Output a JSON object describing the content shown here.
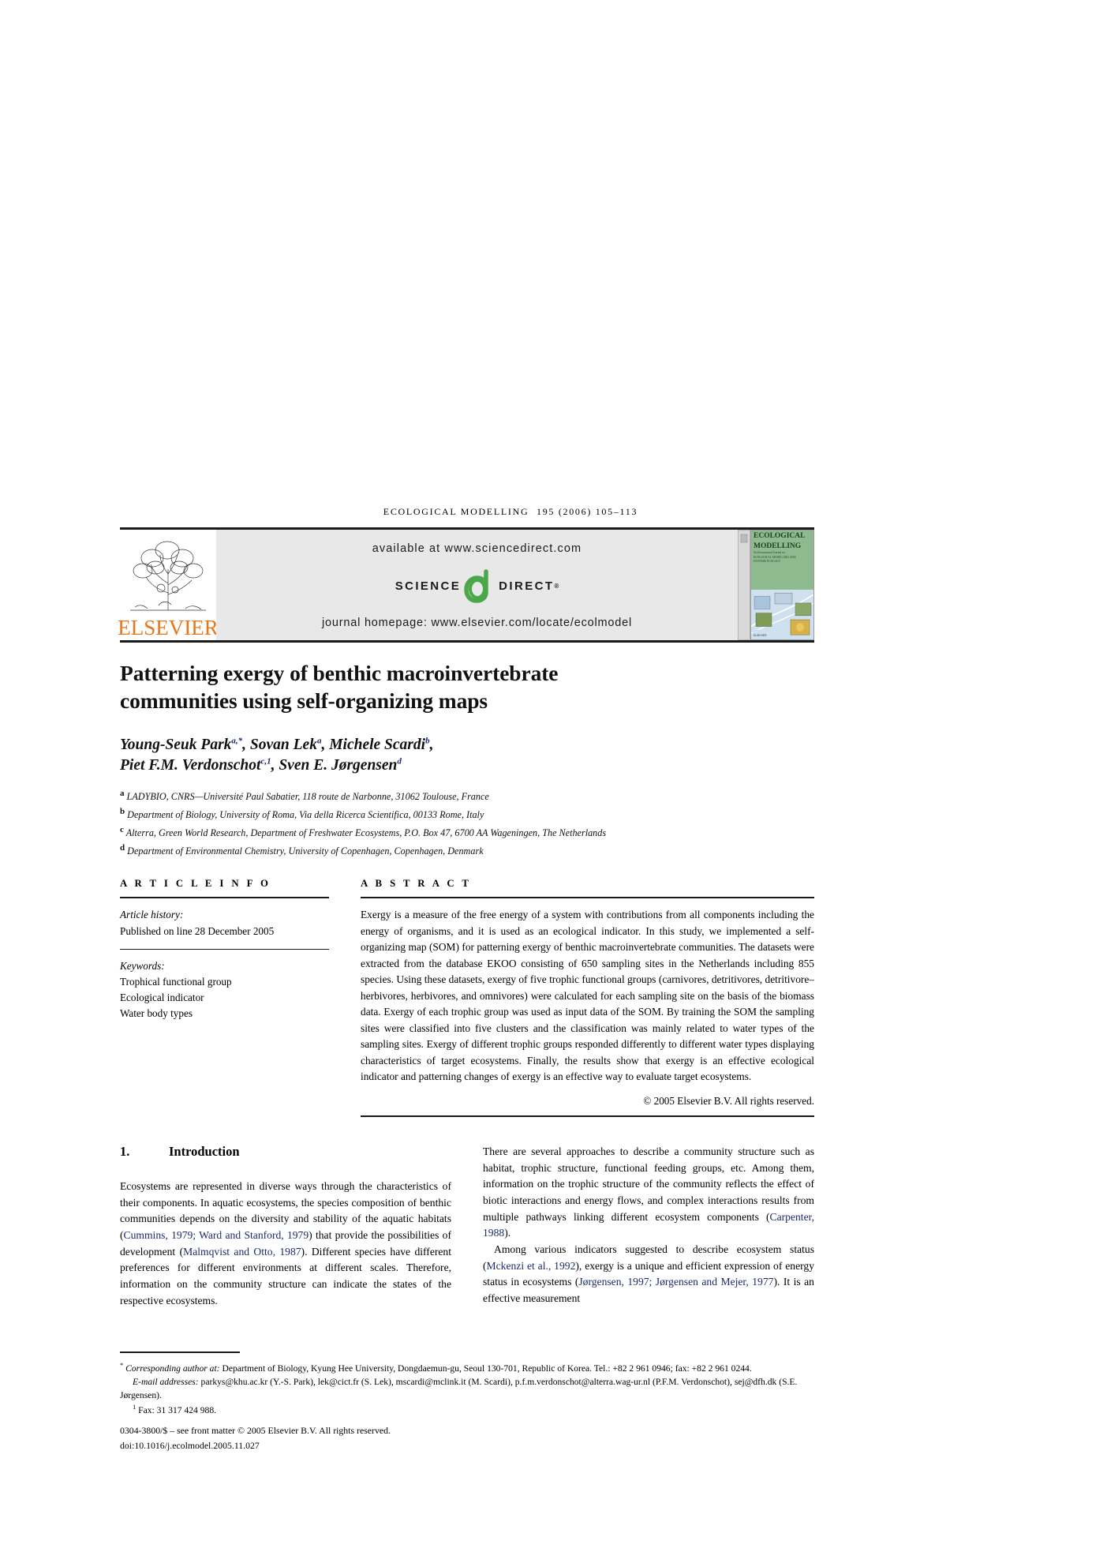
{
  "running_head": {
    "journal": "ECOLOGICAL MODELLING",
    "citation": "195 (2006) 105–113"
  },
  "masthead": {
    "publisher_name": "ELSEVIER",
    "available_at": "available at www.sciencedirect.com",
    "science_word": "SCIENCE",
    "direct_word": "DIRECT",
    "registered_mark": "®",
    "journal_homepage": "journal homepage: www.elsevier.com/locate/ecolmodel",
    "cover": {
      "line1": "ECOLOGICAL",
      "line2": "MODELLING",
      "sub1": "An International Journal on",
      "sub2": "ECOLOGICAL MODELLING AND",
      "sub3": "SYSTEMS ECOLOGY",
      "footer1": "ELSEVIER",
      "footer2": "www.elsevier.com"
    }
  },
  "article": {
    "title_line1": "Patterning exergy of benthic macroinvertebrate",
    "title_line2": "communities using self-organizing maps",
    "authors_line1_parts": [
      {
        "name": "Young-Seuk Park",
        "sup": "a,*"
      },
      {
        "name": "Sovan Lek",
        "sup": "a"
      },
      {
        "name": "Michele Scardi",
        "sup": "b"
      }
    ],
    "authors_line2_parts": [
      {
        "name": "Piet F.M. Verdonschot",
        "sup": "c,1"
      },
      {
        "name": "Sven E. Jørgensen",
        "sup": "d"
      }
    ],
    "affiliations": [
      {
        "marker": "a",
        "text": "LADYBIO, CNRS—Université Paul Sabatier, 118 route de Narbonne, 31062 Toulouse, France"
      },
      {
        "marker": "b",
        "text": "Department of Biology, University of Roma, Via della Ricerca Scientifica, 00133 Rome, Italy"
      },
      {
        "marker": "c",
        "text": "Alterra, Green World Research, Department of Freshwater Ecosystems, P.O. Box 47, 6700 AA Wageningen, The Netherlands"
      },
      {
        "marker": "d",
        "text": "Department of Environmental Chemistry, University of Copenhagen, Copenhagen, Denmark"
      }
    ]
  },
  "article_info": {
    "heading": "A R T I C L E  I N F O",
    "history_label": "Article history:",
    "history_value": "Published on line 28 December 2005",
    "keywords_label": "Keywords:",
    "keywords": [
      "Trophical functional group",
      "Ecological indicator",
      "Water body types"
    ]
  },
  "abstract": {
    "heading": "A B S T R A C T",
    "text": "Exergy is a measure of the free energy of a system with contributions from all components including the energy of organisms, and it is used as an ecological indicator. In this study, we implemented a self-organizing map (SOM) for patterning exergy of benthic macroinvertebrate communities. The datasets were extracted from the database EKOO consisting of 650 sampling sites in the Netherlands including 855 species. Using these datasets, exergy of five trophic functional groups (carnivores, detritivores, detritivore–herbivores, herbivores, and omnivores) were calculated for each sampling site on the basis of the biomass data. Exergy of each trophic group was used as input data of the SOM. By training the SOM the sampling sites were classified into five clusters and the classification was mainly related to water types of the sampling sites. Exergy of different trophic groups responded differently to different water types displaying characteristics of target ecosystems. Finally, the results show that exergy is an effective ecological indicator and patterning changes of exergy is an effective way to evaluate target ecosystems.",
    "copyright": "© 2005 Elsevier B.V. All rights reserved."
  },
  "introduction": {
    "number": "1.",
    "heading": "Introduction",
    "left_paragraph_segments": [
      {
        "type": "text",
        "value": "Ecosystems are represented in diverse ways through the characteristics of their components. In aquatic ecosystems, the species composition of benthic communities depends on the diversity and stability of the aquatic habitats ("
      },
      {
        "type": "cite",
        "value": "Cummins, 1979; Ward and Stanford, 1979"
      },
      {
        "type": "text",
        "value": ") that provide the possibilities of development ("
      },
      {
        "type": "cite",
        "value": "Malmqvist and Otto, 1987"
      },
      {
        "type": "text",
        "value": "). Different species have different preferences for different environments at different scales. Therefore, information on the community structure can indicate the states of the respective ecosystems."
      }
    ],
    "right_paragraph1_segments": [
      {
        "type": "text",
        "value": "There are several approaches to describe a community structure such as habitat, trophic structure, functional feeding groups, etc. Among them, information on the trophic structure of the community reflects the effect of biotic interactions and energy flows, and complex interactions results from multiple pathways linking different ecosystem components ("
      },
      {
        "type": "cite",
        "value": "Carpenter, 1988"
      },
      {
        "type": "text",
        "value": ")."
      }
    ],
    "right_paragraph2_segments": [
      {
        "type": "text",
        "value": "Among various indicators suggested to describe ecosystem status ("
      },
      {
        "type": "cite",
        "value": "Mckenzi et al., 1992"
      },
      {
        "type": "text",
        "value": "), exergy is a unique and efficient expression of energy status in ecosystems ("
      },
      {
        "type": "cite",
        "value": "Jørgensen, 1997; Jørgensen and Mejer, 1977"
      },
      {
        "type": "text",
        "value": "). It is an effective measurement"
      }
    ]
  },
  "footnotes": {
    "corresponding_marker": "*",
    "corresponding_label": "Corresponding author at:",
    "corresponding_text": "Department of Biology, Kyung Hee University, Dongdaemun-gu, Seoul 130-701, Republic of Korea. Tel.: +82 2 961 0946; fax: +82 2 961 0244.",
    "email_label": "E-mail addresses:",
    "email_text": "parkys@khu.ac.kr (Y.-S. Park), lek@cict.fr (S. Lek), mscardi@mclink.it (M. Scardi), p.f.m.verdonschot@alterra.wag-ur.nl (P.F.M. Verdonschot), sej@dfh.dk (S.E. Jørgensen).",
    "fax_marker": "1",
    "fax_text": "Fax: 31 317 424 988.",
    "front_matter": "0304-3800/$ – see front matter © 2005 Elsevier B.V. All rights reserved.",
    "doi": "doi:10.1016/j.ecolmodel.2005.11.027"
  },
  "colors": {
    "citation_blue": "#1b2a6b",
    "elsevier_orange": "#E8761A",
    "sciencedirect_green": "#4aa84a",
    "masthead_gray": "#e8e8e8"
  }
}
